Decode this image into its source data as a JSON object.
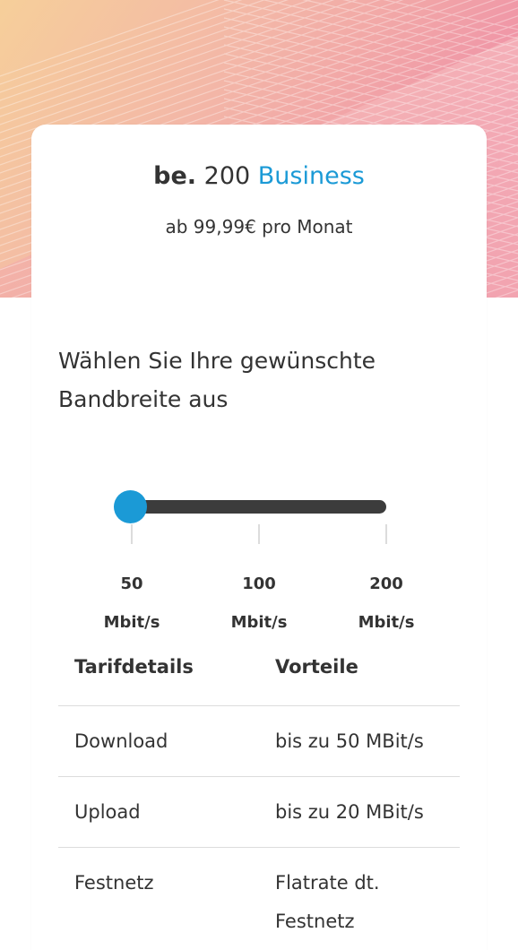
{
  "product": {
    "brand": "be.",
    "speed": "200",
    "name": "Business",
    "price_line": "ab 99,99€ pro Monat"
  },
  "bandwidth": {
    "heading_line1": "Wählen Sie Ihre gewünschte",
    "heading_line2": "Bandbreite aus",
    "options": [
      {
        "value": "50",
        "unit": "Mbit/s"
      },
      {
        "value": "100",
        "unit": "Mbit/s"
      },
      {
        "value": "200",
        "unit": "Mbit/s"
      }
    ],
    "selected_value": "50"
  },
  "table": {
    "headers": [
      "Tarifdetails",
      "Vorteile"
    ],
    "rows": [
      {
        "label": "Download",
        "value": "bis zu 50 MBit/s"
      },
      {
        "label": "Upload",
        "value": "bis zu 20 MBit/s"
      },
      {
        "label": "Festnetz",
        "value": "Flatrate dt. Festnetz"
      }
    ]
  },
  "colors": {
    "accent": "#1b9ad6",
    "text": "#333333",
    "slider_track": "#3c3c3c"
  }
}
